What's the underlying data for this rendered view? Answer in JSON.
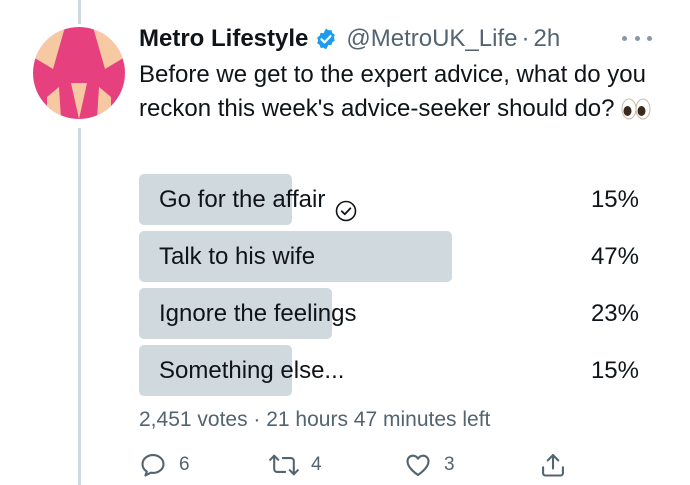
{
  "tweet": {
    "display_name": "Metro Lifestyle",
    "handle": "@MetroUK_Life",
    "separator": "·",
    "time": "2h",
    "text": "Before we get to the expert advice, what do you reckon this week's advice-seeker should do?"
  },
  "poll": {
    "options": [
      {
        "label": "Go for the affair",
        "percent_text": "15%",
        "percent": 15,
        "selected": true
      },
      {
        "label": "Talk to his wife",
        "percent_text": "47%",
        "percent": 47,
        "selected": false
      },
      {
        "label": "Ignore the feelings",
        "percent_text": "23%",
        "percent": 23,
        "selected": false
      },
      {
        "label": "Something else...",
        "percent_text": "15%",
        "percent": 15,
        "selected": false
      }
    ],
    "meta": "2,451 votes · 21 hours 47 minutes left"
  },
  "actions": {
    "reply_count": "6",
    "retweet_count": "4",
    "like_count": "3"
  },
  "colors": {
    "bar": "#cfd9de",
    "verified": "#1d9bf0",
    "secondary_text": "#536471",
    "avatar_pink": "#e7407e",
    "avatar_peach": "#f6c9a3"
  },
  "icons": [
    "verified-badge-icon",
    "more-icon",
    "eyes-emoji-icon",
    "check-circle-icon",
    "reply-icon",
    "retweet-icon",
    "like-icon",
    "share-icon"
  ]
}
